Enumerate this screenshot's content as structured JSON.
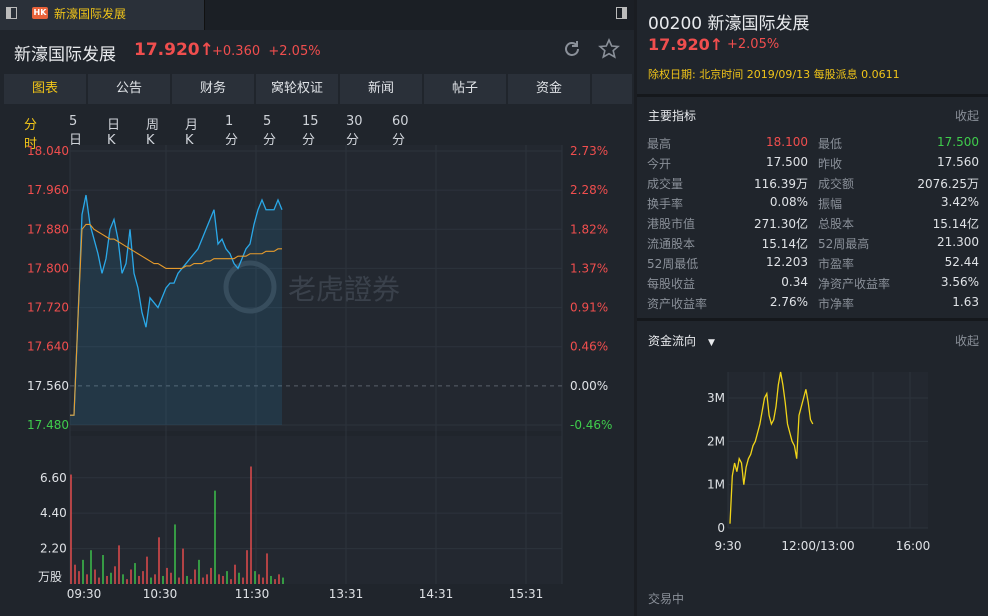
{
  "window": {
    "tab_badge": "HK",
    "tab_title": "新濠国际发展"
  },
  "header": {
    "name": "新濠国际发展",
    "price": "17.920↑",
    "change": "+0.360",
    "change_pct": "+2.05%"
  },
  "nav_tabs": [
    "图表",
    "公告",
    "财务",
    "窝轮权证",
    "新闻",
    "帖子",
    "资金"
  ],
  "periods": [
    "分时",
    "5日",
    "日K",
    "周K",
    "月K",
    "1分",
    "5分",
    "15分",
    "30分",
    "60分"
  ],
  "colors": {
    "up": "#f04e4e",
    "down": "#3fcc4c",
    "accent": "#f0c419",
    "line": "#2aa8e8",
    "avg": "#e59a2c"
  },
  "chart_data": [
    {
      "type": "line",
      "title": "",
      "y_left_ticks": [
        "18.040",
        "17.960",
        "17.880",
        "17.800",
        "17.720",
        "17.640",
        "17.560",
        "17.480"
      ],
      "y_right_ticks": [
        "2.73%",
        "2.28%",
        "1.82%",
        "1.37%",
        "0.91%",
        "0.46%",
        "0.00%",
        "-0.46%"
      ],
      "ylim": [
        17.48,
        18.04
      ],
      "prev_close": 17.56,
      "x_ticks": [
        "09:30",
        "10:30",
        "11:30",
        "13:31",
        "14:31",
        "15:31"
      ],
      "watermark": "老虎證券",
      "series": [
        {
          "values": [
            17.5,
            17.5,
            17.7,
            17.91,
            17.95,
            17.89,
            17.86,
            17.83,
            17.79,
            17.82,
            17.88,
            17.9,
            17.86,
            17.79,
            17.81,
            17.88,
            17.79,
            17.76,
            17.71,
            17.68,
            17.74,
            17.73,
            17.72,
            17.74,
            17.76,
            17.77,
            17.77,
            17.79,
            17.8,
            17.81,
            17.82,
            17.83,
            17.84,
            17.86,
            17.88,
            17.9,
            17.92,
            17.85,
            17.86,
            17.84,
            17.83,
            17.81,
            17.8,
            17.82,
            17.84,
            17.85,
            17.89,
            17.92,
            17.94,
            17.92,
            17.92,
            17.92,
            17.94,
            17.92
          ]
        },
        {
          "values": [
            17.5,
            17.5,
            17.7,
            17.88,
            17.89,
            17.89,
            17.88,
            17.875,
            17.87,
            17.865,
            17.86,
            17.86,
            17.855,
            17.85,
            17.845,
            17.84,
            17.835,
            17.83,
            17.825,
            17.82,
            17.815,
            17.81,
            17.81,
            17.805,
            17.8,
            17.8,
            17.8,
            17.8,
            17.8,
            17.805,
            17.805,
            17.81,
            17.81,
            17.81,
            17.815,
            17.815,
            17.82,
            17.82,
            17.82,
            17.82,
            17.82,
            17.82,
            17.825,
            17.825,
            17.825,
            17.83,
            17.83,
            17.83,
            17.83,
            17.835,
            17.835,
            17.835,
            17.84,
            17.84
          ]
        }
      ]
    },
    {
      "type": "bar",
      "title": "",
      "y_ticks": [
        "6.60",
        "4.40",
        "2.20"
      ],
      "unit": "万股",
      "ylim": [
        0,
        8.2
      ],
      "values": [
        6.8,
        1.2,
        0.8,
        1.5,
        0.6,
        2.1,
        0.9,
        0.4,
        1.8,
        0.5,
        0.7,
        1.1,
        2.4,
        0.6,
        0.3,
        0.9,
        1.3,
        0.5,
        0.8,
        1.7,
        0.4,
        0.6,
        2.9,
        0.5,
        1.0,
        0.7,
        3.7,
        0.4,
        2.2,
        0.5,
        0.3,
        0.9,
        1.5,
        0.4,
        0.6,
        1.0,
        5.8,
        0.6,
        0.5,
        0.8,
        0.3,
        1.2,
        0.7,
        0.4,
        2.1,
        7.3,
        0.8,
        0.6,
        0.4,
        1.9,
        0.5,
        0.3,
        0.6,
        0.4
      ],
      "colors": [
        "up",
        "up",
        "up",
        "down",
        "up",
        "down",
        "up",
        "up",
        "down",
        "up",
        "down",
        "up",
        "up",
        "down",
        "up",
        "up",
        "down",
        "up",
        "up",
        "up",
        "down",
        "up",
        "up",
        "down",
        "up",
        "up",
        "down",
        "up",
        "up",
        "down",
        "up",
        "up",
        "down",
        "up",
        "up",
        "up",
        "down",
        "up",
        "up",
        "down",
        "up",
        "up",
        "down",
        "up",
        "up",
        "up",
        "down",
        "up",
        "up",
        "up",
        "down",
        "up",
        "up",
        "down"
      ]
    },
    {
      "type": "line",
      "title": "",
      "y_ticks": [
        "3M",
        "2M",
        "1M",
        "0"
      ],
      "ylim": [
        0,
        3.6
      ],
      "x_ticks": [
        "9:30",
        "12:00/13:00",
        "16:00"
      ],
      "values": [
        0.1,
        1.2,
        1.5,
        1.3,
        1.6,
        1.5,
        1.0,
        1.4,
        1.6,
        1.7,
        1.9,
        2.0,
        2.2,
        2.4,
        2.7,
        3.0,
        3.1,
        2.6,
        2.4,
        2.5,
        2.8,
        3.3,
        3.6,
        3.3,
        2.9,
        2.4,
        2.2,
        2.0,
        1.9,
        1.6,
        2.6,
        2.8,
        3.0,
        3.2,
        2.9,
        2.5,
        2.4
      ]
    }
  ],
  "info": {
    "code": "00200",
    "name": "新濠国际发展",
    "price": "17.920↑",
    "change_pct": "+2.05%",
    "dividend": "除权日期: 北京时间 2019/09/13 每股派息 0.0611"
  },
  "indicators": {
    "title": "主要指标",
    "collapse": "收起",
    "rows": [
      [
        "最高",
        "18.100",
        "最低",
        "17.500"
      ],
      [
        "今开",
        "17.500",
        "昨收",
        "17.560"
      ],
      [
        "成交量",
        "116.39万",
        "成交额",
        "2076.25万"
      ],
      [
        "换手率",
        "0.08%",
        "振幅",
        "3.42%"
      ],
      [
        "港股市值",
        "271.30亿",
        "总股本",
        "15.14亿"
      ],
      [
        "流通股本",
        "15.14亿",
        "52周最高",
        "21.300"
      ],
      [
        "52周最低",
        "12.203",
        "市盈率",
        "52.44"
      ],
      [
        "每股收益",
        "0.34",
        "净资产收益率",
        "3.56%"
      ],
      [
        "资产收益率",
        "2.76%",
        "市净率",
        "1.63"
      ]
    ]
  },
  "fund_flow": {
    "title": "资金流向",
    "collapse": "收起"
  },
  "status": "交易中"
}
